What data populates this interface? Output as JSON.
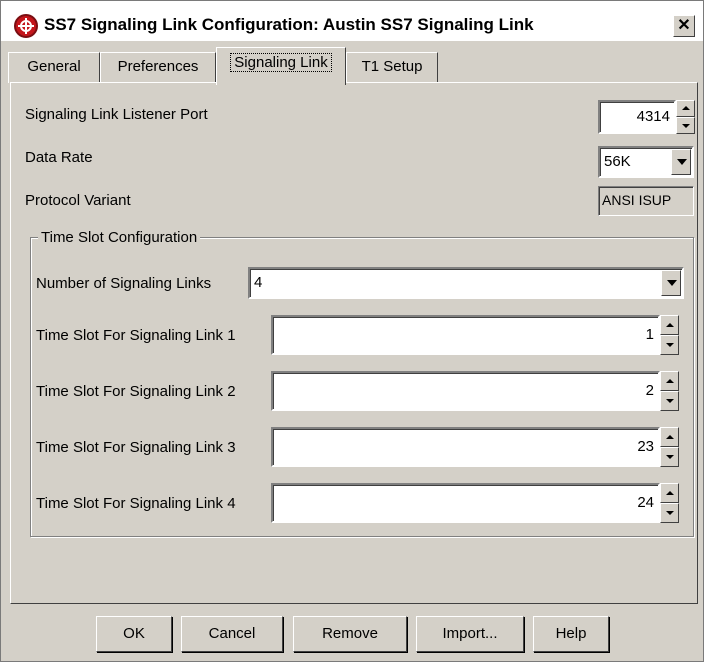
{
  "window": {
    "title": "SS7 Signaling Link Configuration: Austin SS7 Signaling Link",
    "close_glyph": "✕"
  },
  "tabs": [
    {
      "label": "General",
      "active": false
    },
    {
      "label": "Preferences",
      "active": false
    },
    {
      "label": "Signaling Link",
      "active": true
    },
    {
      "label": "T1 Setup",
      "active": false
    }
  ],
  "fields": {
    "listener_port": {
      "label": "Signaling Link Listener Port",
      "value": "4314"
    },
    "data_rate": {
      "label": "Data Rate",
      "value": "56K"
    },
    "protocol_variant": {
      "label": "Protocol Variant",
      "value": "ANSI ISUP"
    }
  },
  "time_slot_group": {
    "title": "Time Slot Configuration",
    "num_links": {
      "label": "Number of Signaling Links",
      "value": "4"
    },
    "slots": [
      {
        "label": "Time Slot For Signaling Link 1",
        "value": "1"
      },
      {
        "label": "Time Slot For Signaling Link 2",
        "value": "2"
      },
      {
        "label": "Time Slot For Signaling Link 3",
        "value": "23"
      },
      {
        "label": "Time Slot For Signaling Link 4",
        "value": "24"
      }
    ]
  },
  "buttons": {
    "ok": "OK",
    "cancel": "Cancel",
    "remove": "Remove",
    "import": "Import...",
    "help": "Help"
  },
  "colors": {
    "window_bg": "#d4d0c8",
    "app_icon": "#c4161c"
  }
}
